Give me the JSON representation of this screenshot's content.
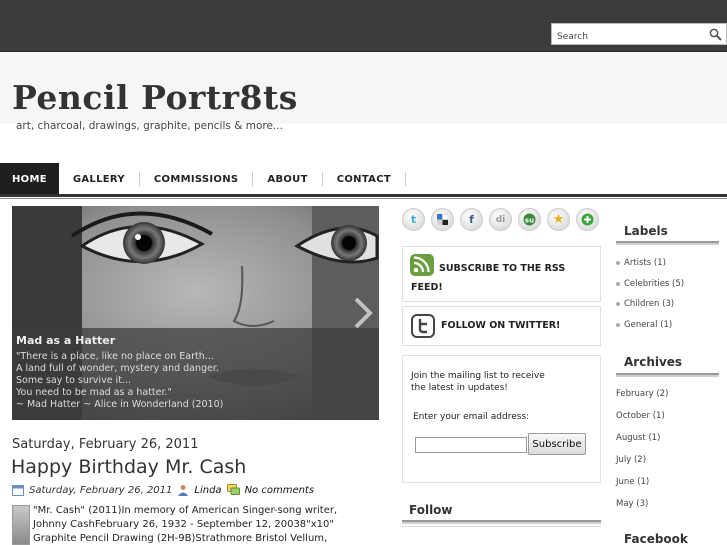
{
  "search": {
    "placeholder": "Search"
  },
  "site": {
    "title": "Pencil Portr8ts",
    "tagline": "art, charcoal, drawings, graphite, pencils & more..."
  },
  "nav": [
    "HOME",
    "GALLERY",
    "COMMISSIONS",
    "ABOUT",
    "CONTACT"
  ],
  "slider": {
    "title": "Mad as a Hatter",
    "lines": [
      "\"There is a place, like no place on Earth...",
      "A land full of wonder, mystery and danger.",
      "Some say to survive it...",
      "You need to be mad as a hatter.\"",
      "~ Mad Hatter ~ Alice in Wonderland (2010)"
    ]
  },
  "post": {
    "date_header": "Saturday, February 26, 2011",
    "title": "Happy Birthday Mr. Cash",
    "meta_date": "Saturday, February 26, 2011",
    "author": "Linda",
    "comments": "No comments",
    "body_lines": [
      "\"Mr. Cash\" (2011)In memory of American Singer-song writer,",
      "Johnny CashFebruary 26, 1932 - September 12, 20038\"x10\"",
      "Graphite Pencil Drawing (2H-9B)Strathmore Bristol Vellum,"
    ]
  },
  "social_icons": [
    "twitter-icon",
    "delicious-icon",
    "facebook-icon",
    "digg-icon",
    "stumbleupon-icon",
    "favorite-star-icon",
    "add-icon"
  ],
  "widgets": {
    "rss": "SUBSCRIBE TO THE RSS FEED!",
    "twitter": "FOLLOW ON TWITTER!",
    "mailing_text": "Join the mailing list to receive the latest in updates!",
    "email_label": "Enter your email address:",
    "subscribe_button": "Subscribe",
    "follow_title": "Follow"
  },
  "labels": {
    "title": "Labels",
    "items": [
      "Artists (1)",
      "Celebrities (5)",
      "Children (3)",
      "General (1)"
    ]
  },
  "archives": {
    "title": "Archives",
    "items": [
      "February (2)",
      "October (1)",
      "August (1)",
      "July (2)",
      "June (1)",
      "May (3)"
    ]
  },
  "facebook": {
    "title": "Facebook"
  },
  "colors": {
    "topbar": "#3c3c3c",
    "nav_active": "#1f1f1f",
    "header_bg": "#f6f6f6"
  }
}
